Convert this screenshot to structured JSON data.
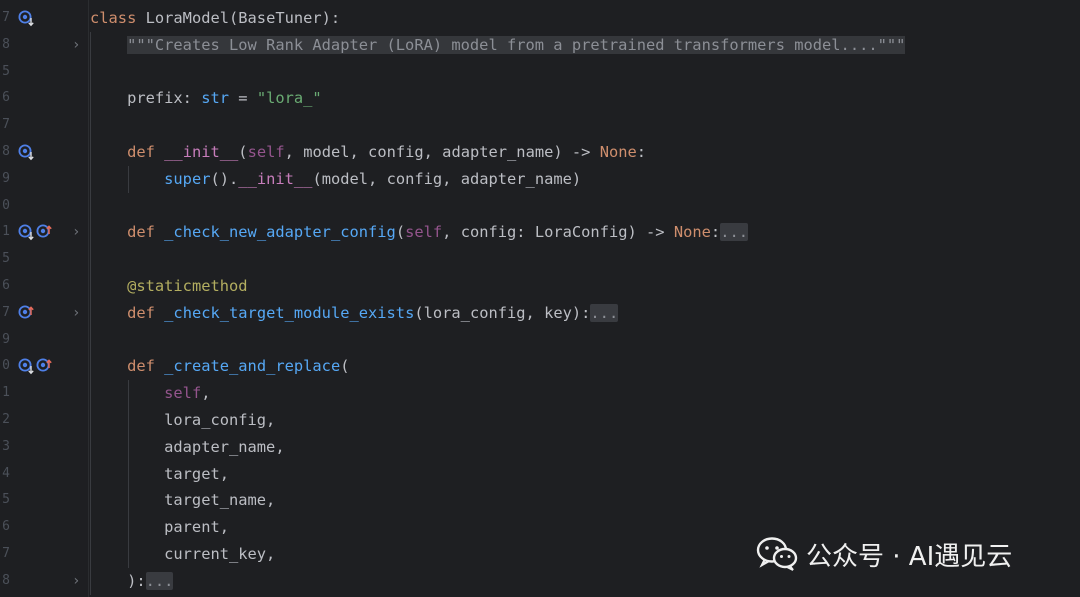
{
  "editor": {
    "lines": [
      {
        "num": "7",
        "gutter": [
          "override-down"
        ],
        "fold": false,
        "tokens": [
          {
            "t": "class ",
            "c": "kw"
          },
          {
            "t": "LoraModel(BaseTuner):",
            "c": ""
          }
        ]
      },
      {
        "num": "8",
        "gutter": [],
        "fold": true,
        "tokens": [
          {
            "t": "    ",
            "c": ""
          },
          {
            "t": "\"\"\"Creates Low Rank Adapter (LoRA) model from a pretrained transformers model....\"\"\"",
            "c": "doc"
          }
        ]
      },
      {
        "num": "5",
        "gutter": [],
        "fold": false,
        "tokens": []
      },
      {
        "num": "6",
        "gutter": [],
        "fold": false,
        "tokens": [
          {
            "t": "    prefix: ",
            "c": ""
          },
          {
            "t": "str",
            "c": "fn"
          },
          {
            "t": " = ",
            "c": ""
          },
          {
            "t": "\"lora_\"",
            "c": "str"
          }
        ]
      },
      {
        "num": "7",
        "gutter": [],
        "fold": false,
        "tokens": []
      },
      {
        "num": "8",
        "gutter": [
          "override-down"
        ],
        "fold": false,
        "tokens": [
          {
            "t": "    ",
            "c": ""
          },
          {
            "t": "def ",
            "c": "kw"
          },
          {
            "t": "__init__",
            "c": "magic"
          },
          {
            "t": "(",
            "c": ""
          },
          {
            "t": "self",
            "c": "self"
          },
          {
            "t": ", model, config, adapter_name) -> ",
            "c": ""
          },
          {
            "t": "None",
            "c": "kw"
          },
          {
            "t": ":",
            "c": ""
          }
        ]
      },
      {
        "num": "9",
        "gutter": [],
        "fold": false,
        "tokens": [
          {
            "t": "        ",
            "c": ""
          },
          {
            "t": "super",
            "c": "fn"
          },
          {
            "t": "().",
            "c": ""
          },
          {
            "t": "__init__",
            "c": "magic"
          },
          {
            "t": "(model, config, adapter_name)",
            "c": ""
          }
        ]
      },
      {
        "num": "0",
        "gutter": [],
        "fold": false,
        "tokens": []
      },
      {
        "num": "1",
        "gutter": [
          "override-down",
          "override-up"
        ],
        "fold": true,
        "tokens": [
          {
            "t": "    ",
            "c": ""
          },
          {
            "t": "def ",
            "c": "kw"
          },
          {
            "t": "_check_new_adapter_config",
            "c": "fn"
          },
          {
            "t": "(",
            "c": ""
          },
          {
            "t": "self",
            "c": "self"
          },
          {
            "t": ", config: LoraConfig) -> ",
            "c": ""
          },
          {
            "t": "None",
            "c": "kw"
          },
          {
            "t": ":",
            "c": ""
          },
          {
            "t": "...",
            "c": "folded"
          }
        ]
      },
      {
        "num": "5",
        "gutter": [],
        "fold": false,
        "tokens": []
      },
      {
        "num": "6",
        "gutter": [],
        "fold": false,
        "tokens": [
          {
            "t": "    ",
            "c": ""
          },
          {
            "t": "@staticmethod",
            "c": "deco"
          }
        ]
      },
      {
        "num": "7",
        "gutter": [
          "override-up"
        ],
        "fold": true,
        "tokens": [
          {
            "t": "    ",
            "c": ""
          },
          {
            "t": "def ",
            "c": "kw"
          },
          {
            "t": "_check_target_module_exists",
            "c": "fn"
          },
          {
            "t": "(lora_config, key):",
            "c": ""
          },
          {
            "t": "...",
            "c": "folded"
          }
        ]
      },
      {
        "num": "9",
        "gutter": [],
        "fold": false,
        "tokens": []
      },
      {
        "num": "0",
        "gutter": [
          "override-down",
          "override-up"
        ],
        "fold": false,
        "tokens": [
          {
            "t": "    ",
            "c": ""
          },
          {
            "t": "def ",
            "c": "kw"
          },
          {
            "t": "_create_and_replace",
            "c": "fn"
          },
          {
            "t": "(",
            "c": ""
          }
        ]
      },
      {
        "num": "1",
        "gutter": [],
        "fold": false,
        "tokens": [
          {
            "t": "        ",
            "c": ""
          },
          {
            "t": "self",
            "c": "self"
          },
          {
            "t": ",",
            "c": ""
          }
        ]
      },
      {
        "num": "2",
        "gutter": [],
        "fold": false,
        "tokens": [
          {
            "t": "        lora_config,",
            "c": ""
          }
        ]
      },
      {
        "num": "3",
        "gutter": [],
        "fold": false,
        "tokens": [
          {
            "t": "        adapter_name,",
            "c": ""
          }
        ]
      },
      {
        "num": "4",
        "gutter": [],
        "fold": false,
        "tokens": [
          {
            "t": "        target,",
            "c": ""
          }
        ]
      },
      {
        "num": "5",
        "gutter": [],
        "fold": false,
        "tokens": [
          {
            "t": "        target_name,",
            "c": ""
          }
        ]
      },
      {
        "num": "6",
        "gutter": [],
        "fold": false,
        "tokens": [
          {
            "t": "        parent,",
            "c": ""
          }
        ]
      },
      {
        "num": "7",
        "gutter": [],
        "fold": false,
        "tokens": [
          {
            "t": "        current_key,",
            "c": ""
          }
        ]
      },
      {
        "num": "8",
        "gutter": [],
        "fold": true,
        "tokens": [
          {
            "t": "    ):",
            "c": ""
          },
          {
            "t": "...",
            "c": "folded"
          }
        ]
      }
    ]
  },
  "watermark": {
    "text": "公众号 · AI遇见云",
    "icon": "wechat-icon"
  },
  "colors": {
    "background": "#1e1f22",
    "keyword": "#cf8e6d",
    "function": "#56a8f5",
    "self": "#94558d",
    "string": "#6aab73",
    "decorator": "#b3ae60",
    "default": "#bcbec4",
    "override_icon": "#4f80e8",
    "implemented_icon": "#e66b5b"
  }
}
